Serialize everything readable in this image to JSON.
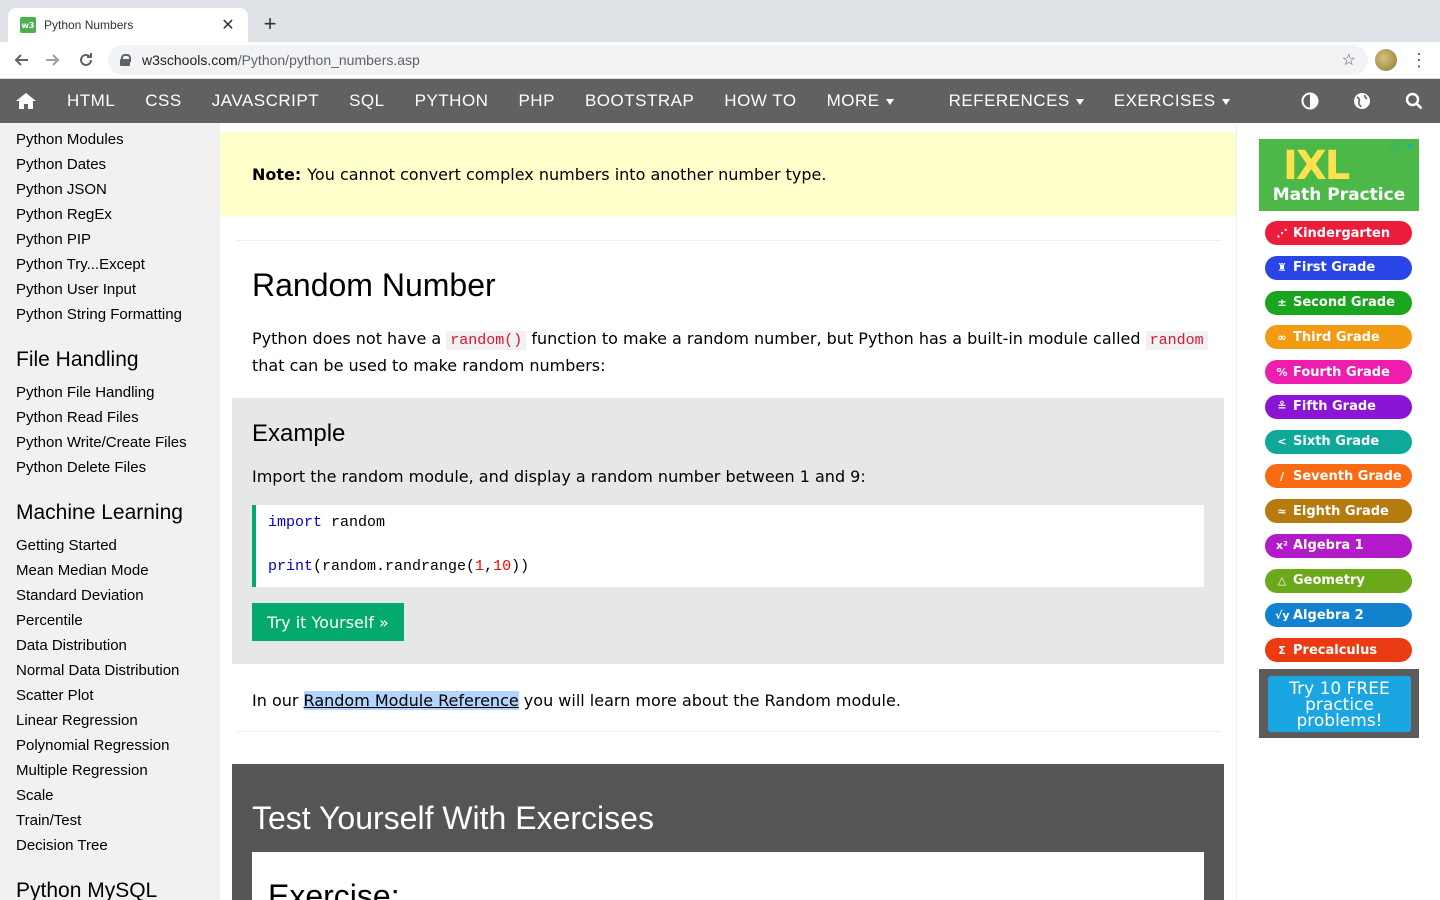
{
  "browser": {
    "tab_title": "Python Numbers",
    "favicon_text": "w3",
    "url_host": "w3schools.com",
    "url_path": "/Python/python_numbers.asp"
  },
  "topnav": {
    "items": [
      "HTML",
      "CSS",
      "JAVASCRIPT",
      "SQL",
      "PYTHON",
      "PHP",
      "BOOTSTRAP",
      "HOW TO",
      "MORE",
      "REFERENCES",
      "EXERCISES"
    ],
    "bg_color": "#616161"
  },
  "sidebar": {
    "links_top": [
      "Python Modules",
      "Python Dates",
      "Python JSON",
      "Python RegEx",
      "Python PIP",
      "Python Try...Except",
      "Python User Input",
      "Python String Formatting"
    ],
    "file_handling": {
      "heading": "File Handling",
      "links": [
        "Python File Handling",
        "Python Read Files",
        "Python Write/Create Files",
        "Python Delete Files"
      ]
    },
    "machine_learning": {
      "heading": "Machine Learning",
      "links": [
        "Getting Started",
        "Mean Median Mode",
        "Standard Deviation",
        "Percentile",
        "Data Distribution",
        "Normal Data Distribution",
        "Scatter Plot",
        "Linear Regression",
        "Polynomial Regression",
        "Multiple Regression",
        "Scale",
        "Train/Test",
        "Decision Tree"
      ]
    },
    "mysql_heading": "Python MySQL"
  },
  "main": {
    "note_label": "Note:",
    "note_text": "You cannot convert complex numbers into another number type.",
    "random_heading": "Random Number",
    "random_p1_a": "Python does not have a ",
    "random_p1_code": "random()",
    "random_p1_b": " function to make a random number, but Python has a built-in module called ",
    "random_p1_code2": "random",
    "random_p1_c": "that can be used to make random numbers:",
    "example_title": "Example",
    "example_desc": "Import the random module, and display a random number between 1 and 9:",
    "code": {
      "line1_kw": "import",
      "line1_rest": " random",
      "line2_kw": "print",
      "line2_a": "(random.randrange(",
      "line2_n1": "1",
      "line2_comma": ",",
      "line2_n2": "10",
      "line2_b": "))"
    },
    "try_button": "Try it Yourself »",
    "ref_a": "In our ",
    "ref_link": "Random Module Reference",
    "ref_b": " you will learn more about the Random module.",
    "exercise_heading": "Test Yourself With Exercises",
    "exercise_label": "Exercise:"
  },
  "ad": {
    "logo": "IXL",
    "title": "Math Practice",
    "grades": [
      {
        "label": "Kindergarten",
        "icon": "⋰",
        "color": "#ec1c3b"
      },
      {
        "label": "First Grade",
        "icon": "♜",
        "color": "#2a45e6"
      },
      {
        "label": "Second Grade",
        "icon": "±",
        "color": "#1aa51f"
      },
      {
        "label": "Third Grade",
        "icon": "∞",
        "color": "#f39a13"
      },
      {
        "label": "Fourth Grade",
        "icon": "%",
        "color": "#ee1dad"
      },
      {
        "label": "Fifth Grade",
        "icon": "≗",
        "color": "#8b15d4"
      },
      {
        "label": "Sixth Grade",
        "icon": "<",
        "color": "#0fa99a"
      },
      {
        "label": "Seventh Grade",
        "icon": "∕",
        "color": "#f86b13"
      },
      {
        "label": "Eighth Grade",
        "icon": "≈",
        "color": "#b57b0e"
      },
      {
        "label": "Algebra 1",
        "icon": "x²",
        "color": "#b31ac9"
      },
      {
        "label": "Geometry",
        "icon": "△",
        "color": "#6ba81a"
      },
      {
        "label": "Algebra 2",
        "icon": "√y",
        "color": "#1282cf"
      },
      {
        "label": "Precalculus",
        "icon": "Σ",
        "color": "#eb3b12"
      }
    ],
    "cta_line1": "Try 10 FREE",
    "cta_line2": "practice",
    "cta_line3": "problems!"
  }
}
